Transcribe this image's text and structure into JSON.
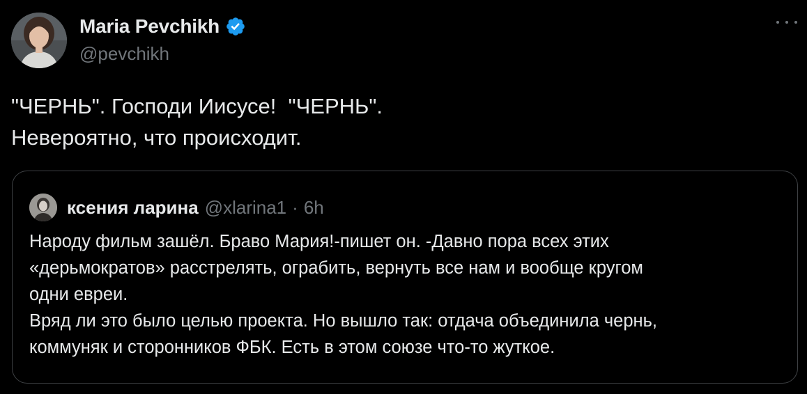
{
  "author": {
    "display_name": "Maria Pevchikh",
    "handle": "@pevchikh",
    "verified_icon": "verified-badge-icon",
    "avatar_icon": "avatar"
  },
  "tweet": {
    "lines": [
      "\"ЧЕРНЬ\". Господи Иисусе!  \"ЧЕРНЬ\".",
      "Невероятно, что происходит."
    ]
  },
  "more_icon": "more-options-icon",
  "quoted_tweet": {
    "display_name": "ксения ларина",
    "handle": "@xlarina1",
    "separator": "·",
    "time": "6h",
    "lines": [
      "Народу фильм зашёл. Браво Мария!-пишет он. -Давно пора всех этих",
      "«дерьмократов» расстрелять, ограбить, вернуть все нам и вообще кругом",
      "одни евреи.",
      "Вряд ли это было целью проекта. Но вышло так: отдача объединила чернь,",
      "коммуняк и сторонников ФБК. Есть в этом союзе что-то жуткое."
    ]
  },
  "colors": {
    "background": "#000000",
    "text_primary": "#e7e9ea",
    "text_secondary": "#71767b",
    "verified_blue": "#1d9bf0",
    "quote_border": "#3e4144"
  }
}
